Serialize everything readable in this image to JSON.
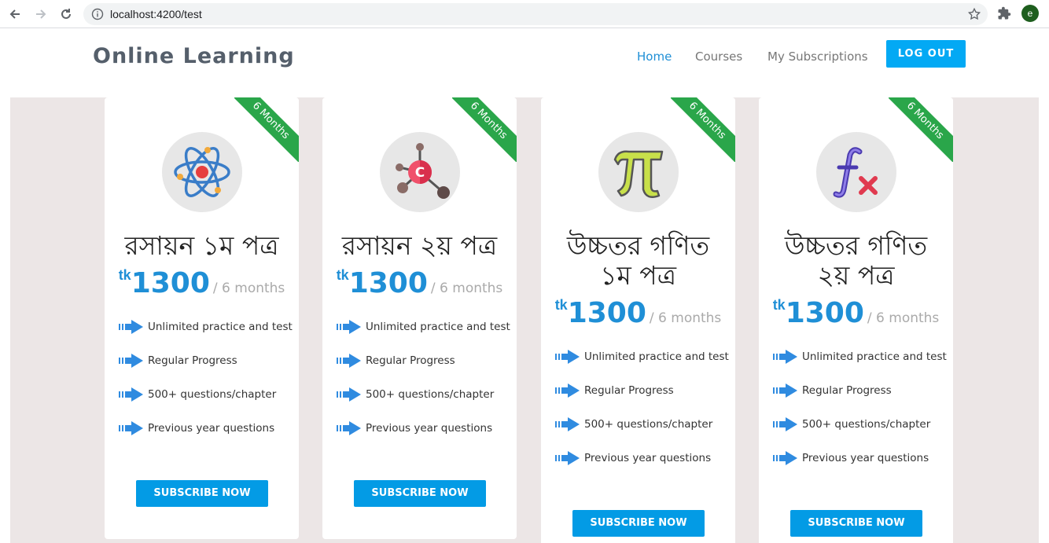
{
  "browser": {
    "url": "localhost:4200/test",
    "avatar_letter": "e"
  },
  "header": {
    "brand": "Online Learning",
    "nav": {
      "home": "Home",
      "courses": "Courses",
      "subscriptions": "My Subscriptions"
    },
    "logout": "LOG OUT"
  },
  "colors": {
    "accent": "#1f8fd6",
    "button": "#039be5",
    "ribbon": "#2aa64a",
    "background": "#ece6e6"
  },
  "cards": [
    {
      "ribbon": "6 Months",
      "icon": "atom-icon",
      "title_lines": [
        "রসায়ন ১ম পত্র"
      ],
      "currency": "tk",
      "price": "1300",
      "period": "/ 6 months",
      "features": [
        "Unlimited practice and test",
        "Regular Progress",
        "500+ questions/chapter",
        "Previous year questions"
      ],
      "button": "SUBSCRIBE NOW"
    },
    {
      "ribbon": "6 Months",
      "icon": "molecule-icon",
      "title_lines": [
        "রসায়ন ২য় পত্র"
      ],
      "currency": "tk",
      "price": "1300",
      "period": "/ 6 months",
      "features": [
        "Unlimited practice and test",
        "Regular Progress",
        "500+ questions/chapter",
        "Previous year questions"
      ],
      "button": "SUBSCRIBE NOW"
    },
    {
      "ribbon": "6 Months",
      "icon": "pi-icon",
      "title_lines": [
        "উচ্চতর গণিত",
        "১ম পত্র"
      ],
      "currency": "tk",
      "price": "1300",
      "period": "/ 6 months",
      "features": [
        "Unlimited practice and test",
        "Regular Progress",
        "500+ questions/chapter",
        "Previous year questions"
      ],
      "button": "SUBSCRIBE NOW"
    },
    {
      "ribbon": "6 Months",
      "icon": "function-icon",
      "title_lines": [
        "উচ্চতর গণিত",
        "২য় পত্র"
      ],
      "currency": "tk",
      "price": "1300",
      "period": "/ 6 months",
      "features": [
        "Unlimited practice and test",
        "Regular Progress",
        "500+ questions/chapter",
        "Previous year questions"
      ],
      "button": "SUBSCRIBE NOW"
    }
  ]
}
